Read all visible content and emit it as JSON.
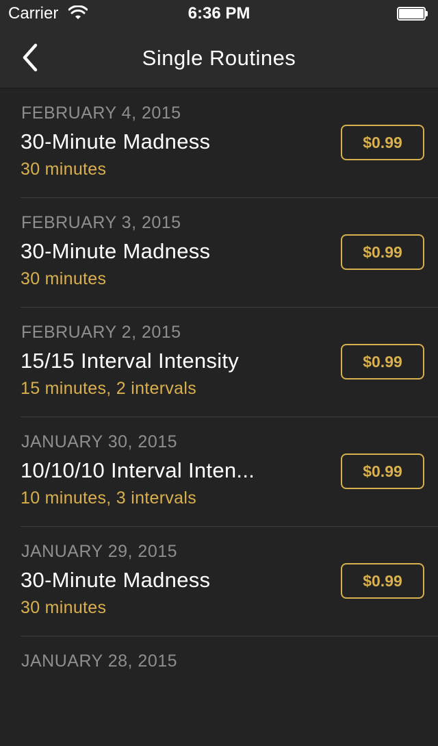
{
  "status_bar": {
    "carrier": "Carrier",
    "time": "6:36 PM",
    "icons": [
      "wifi-icon",
      "battery-icon"
    ]
  },
  "nav": {
    "title": "Single Routines",
    "back_icon": "chevron-left-icon"
  },
  "colors": {
    "background": "#232323",
    "bar": "#2b2b2b",
    "accent": "#d9b04e",
    "date_text": "#8e8e8e",
    "divider": "#3d3d3d"
  },
  "routines": [
    {
      "date": "FEBRUARY 4, 2015",
      "title": "30-Minute Madness",
      "subtitle": "30 minutes",
      "price": "$0.99"
    },
    {
      "date": "FEBRUARY 3, 2015",
      "title": "30-Minute Madness",
      "subtitle": "30 minutes",
      "price": "$0.99"
    },
    {
      "date": "FEBRUARY 2, 2015",
      "title": "15/15 Interval Intensity",
      "subtitle": "15 minutes, 2 intervals",
      "price": "$0.99"
    },
    {
      "date": "JANUARY 30, 2015",
      "title": "10/10/10 Interval Inten...",
      "subtitle": "10 minutes, 3 intervals",
      "price": "$0.99"
    },
    {
      "date": "JANUARY 29, 2015",
      "title": "30-Minute Madness",
      "subtitle": "30 minutes",
      "price": "$0.99"
    },
    {
      "date": "JANUARY 28, 2015",
      "title": "",
      "subtitle": "",
      "price": ""
    }
  ]
}
